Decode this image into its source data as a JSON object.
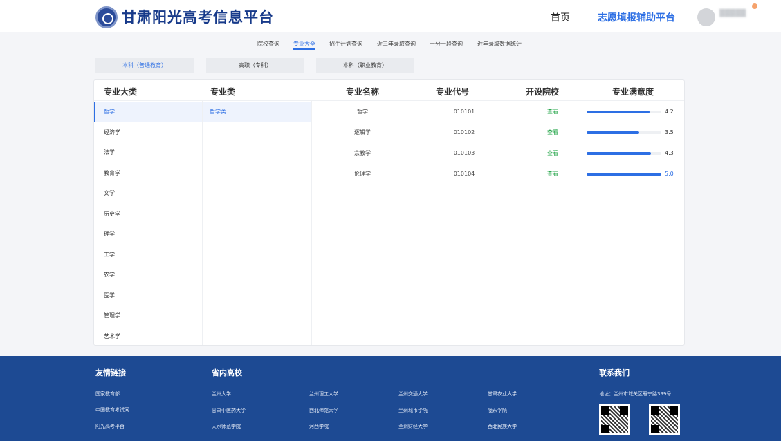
{
  "header": {
    "site_title": "甘肃阳光高考信息平台",
    "nav_home": "首页",
    "nav_platform": "志愿填报辅助平台",
    "accent": "#2d6fe4",
    "brand": "#173a8a"
  },
  "subnav": {
    "items": [
      "院校查询",
      "专业大全",
      "招生计划查询",
      "近三年录取查询",
      "一分一段查询",
      "近年录取数据统计"
    ],
    "active": "专业大全"
  },
  "category_tabs": {
    "items": [
      "本科（普通教育）",
      "高职（专科）",
      "本科（职业教育）"
    ],
    "active": "本科（普通教育）"
  },
  "table": {
    "headers": {
      "category": "专业大类",
      "subcategory": "专业类",
      "name": "专业名称",
      "code": "专业代号",
      "schools": "开设院校",
      "satisfaction": "专业满意度"
    },
    "categories": [
      "哲学",
      "经济学",
      "法学",
      "教育学",
      "文学",
      "历史学",
      "理学",
      "工学",
      "农学",
      "医学",
      "管理学",
      "艺术学"
    ],
    "active_category": "哲学",
    "subcategories": [
      "哲学类"
    ],
    "rows": [
      {
        "name": "哲学",
        "code": "010101",
        "schools": "查看",
        "satisfaction": 4.2,
        "score_text": "4.2"
      },
      {
        "name": "逻辑学",
        "code": "010102",
        "schools": "查看",
        "satisfaction": 3.5,
        "score_text": "3.5"
      },
      {
        "name": "宗教学",
        "code": "010103",
        "schools": "查看",
        "satisfaction": 4.3,
        "score_text": "4.3"
      },
      {
        "name": "伦理学",
        "code": "010104",
        "schools": "查看",
        "satisfaction": 5.0,
        "score_text": "5.0"
      }
    ],
    "satisfaction_max": 5
  },
  "footer": {
    "friend_links_title": "友情链接",
    "friend_links": [
      "国家教育部",
      "中国教育考试网",
      "阳光高考平台"
    ],
    "schools_title": "省内高校",
    "schools": [
      [
        "兰州大学",
        "甘肃中医药大学",
        "天水师范学院"
      ],
      [
        "兰州理工大学",
        "西北师范大学",
        "河西学院"
      ],
      [
        "兰州交通大学",
        "兰州城市学院",
        "兰州财经大学"
      ],
      [
        "甘肃农业大学",
        "陇东学院",
        "西北民族大学"
      ]
    ],
    "contact_title": "联系我们",
    "address": "地址：兰州市城关区雁宁路399号",
    "background": "#1d4a93"
  }
}
